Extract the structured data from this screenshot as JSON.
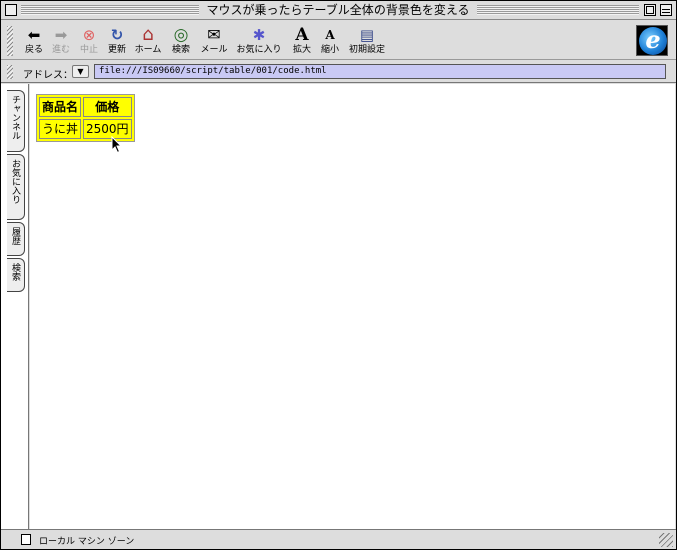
{
  "window": {
    "title": "マウスが乗ったらテーブル全体の背景色を変える"
  },
  "toolbar": {
    "buttons": [
      {
        "label": "戻る",
        "icon": "back-arrow-icon",
        "glyph": "⬅"
      },
      {
        "label": "進む",
        "icon": "forward-arrow-icon",
        "glyph": "➡"
      },
      {
        "label": "中止",
        "icon": "stop-icon",
        "glyph": "⊗"
      },
      {
        "label": "更新",
        "icon": "refresh-icon",
        "glyph": "↻"
      },
      {
        "label": "ホーム",
        "icon": "home-icon",
        "glyph": "⌂"
      },
      {
        "label": "検索",
        "icon": "search-icon",
        "glyph": "◎"
      },
      {
        "label": "メール",
        "icon": "mail-icon",
        "glyph": "✉"
      },
      {
        "label": "お気に入り",
        "icon": "favorites-icon",
        "glyph": "✱"
      },
      {
        "label": "拡大",
        "icon": "text-larger-icon",
        "glyph": "A"
      },
      {
        "label": "縮小",
        "icon": "text-smaller-icon",
        "glyph": "A"
      },
      {
        "label": "初期設定",
        "icon": "preferences-icon",
        "glyph": "▤"
      }
    ]
  },
  "address": {
    "label": "アドレス：",
    "value": "file:///IS09660/script/table/001/code.html"
  },
  "sidetabs": [
    "チャンネル",
    "お気に入り",
    "履歴",
    "検索"
  ],
  "table": {
    "headers": [
      "商品名",
      "価格"
    ],
    "rows": [
      [
        "うに丼",
        "2500円"
      ]
    ],
    "background": "#ffff00"
  },
  "status": {
    "text": "ローカル マシン ゾーン"
  }
}
